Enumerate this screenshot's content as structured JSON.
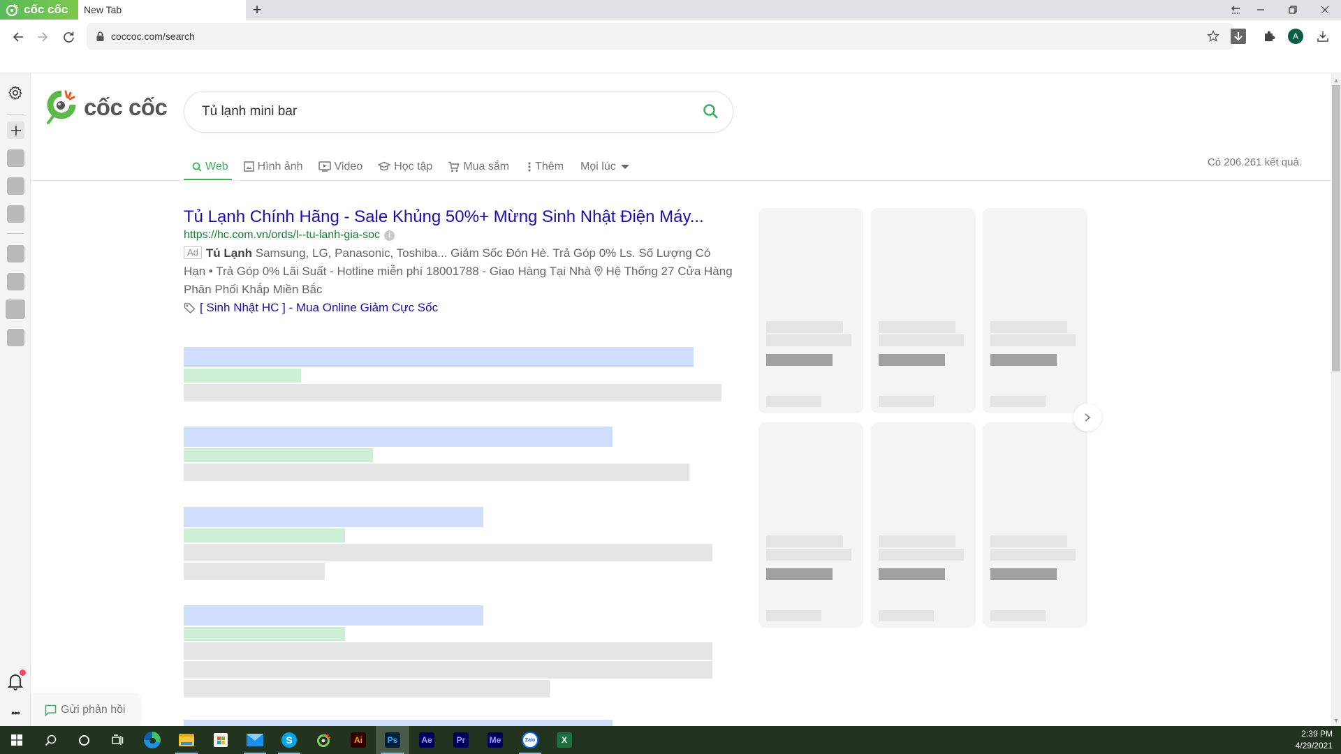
{
  "browser": {
    "brand_tab_label": "cốc cốc",
    "active_tab_title": "New Tab",
    "new_tab_symbol": "+",
    "address": "coccoc.com/search",
    "window_controls": {
      "back_symbol": "⇇",
      "minimize": "—",
      "restore": "❐",
      "close": "✕"
    },
    "profile_initial": "A"
  },
  "sidebar": {
    "settings_icon": "gear-icon",
    "add_icon": "plus-icon",
    "notification_badge_color": "#f4485b",
    "more_label": "•••"
  },
  "search": {
    "logo_text": "cốc cốc",
    "query": "Tủ lạnh mini bar",
    "accent": "#3eb05f"
  },
  "tabs": [
    {
      "label": "Web",
      "icon": "search-icon",
      "active": true
    },
    {
      "label": "Hình ảnh",
      "icon": "image-icon",
      "active": false
    },
    {
      "label": "Video",
      "icon": "video-icon",
      "active": false
    },
    {
      "label": "Học tập",
      "icon": "graduation-cap-icon",
      "active": false
    },
    {
      "label": "Mua sắm",
      "icon": "cart-icon",
      "active": false
    },
    {
      "label": "Thêm",
      "icon": "more-vertical-icon",
      "active": false
    },
    {
      "label": "Mọi lúc",
      "icon": "caret-down-icon",
      "active": false
    }
  ],
  "result_count": "Có 206.261 kết quả.",
  "ad": {
    "title": "Tủ Lạnh Chính Hãng - Sale Khủng 50%+ Mừng Sinh Nhật Điện Máy...",
    "url": "https://hc.com.vn/ords/l--tu-lanh-gia-soc",
    "badge": "Ad",
    "desc_bold": "Tủ Lạnh",
    "desc_part1": " Samsung, LG, Panasonic, Toshiba... Giảm Sốc Đón Hè. Trả Góp 0% Ls. Số Lượng Có Hạn • Trả Góp 0% Lãi Suất - Hotline miễn phí 18001788 - Giao Hàng Tại Nhà ",
    "desc_part2": " Hệ Thống 27 Cửa Hàng Phân Phối Khắp Miền Bắc",
    "sitelink": "[ Sinh Nhật HC ] - Mua Online Giảm Cực Sốc"
  },
  "feedback_label": "Gửi phản hồi",
  "next_symbol": "›",
  "taskbar": {
    "apps": [
      "start",
      "search",
      "cortana",
      "task-view",
      "edge",
      "file-explorer",
      "store",
      "mail",
      "skype",
      "coccoc",
      "illustrator",
      "photoshop",
      "after-effects",
      "premiere",
      "media-encoder",
      "zalo",
      "excel"
    ],
    "app_labels": {
      "illustrator": "Ai",
      "photoshop": "Ps",
      "after_effects": "Ae",
      "premiere": "Pr",
      "media_encoder": "Me",
      "zalo": "Zalo",
      "excel": "X",
      "skype": "S"
    },
    "time": "2:39 PM",
    "date": "4/29/2021"
  }
}
